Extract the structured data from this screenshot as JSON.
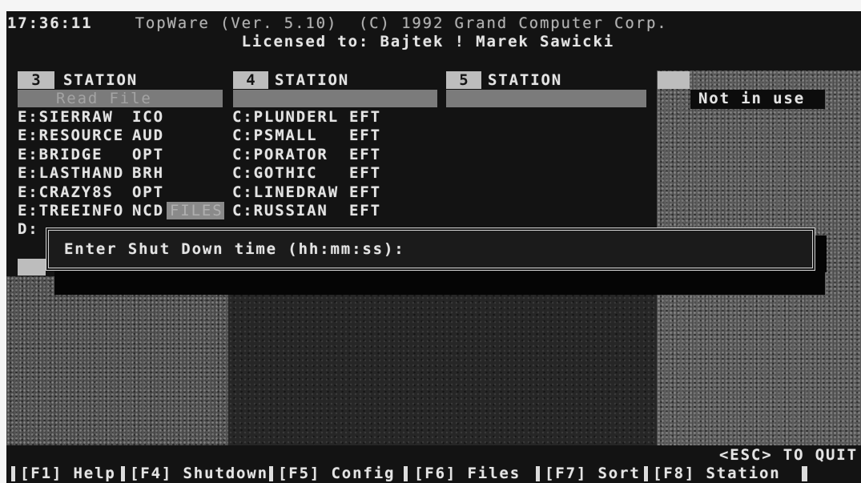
{
  "header": {
    "clock": "17:36:11",
    "title": "TopWare (Ver. 5.10)  (C) 1992 Grand Computer Corp.",
    "license": "Licensed to: Bajtek ! Marek Sawicki"
  },
  "panels": [
    {
      "number": "3",
      "label": "STATION",
      "status": "Read File",
      "highlight": "FILES",
      "drive_row": "D:",
      "files": [
        {
          "name": "E:SIERRAW",
          "ext": "ICO"
        },
        {
          "name": "E:RESOURCE",
          "ext": "AUD"
        },
        {
          "name": "E:BRIDGE",
          "ext": "OPT"
        },
        {
          "name": "E:LASTHAND",
          "ext": "BRH"
        },
        {
          "name": "E:CRAZY8S",
          "ext": "OPT"
        },
        {
          "name": "E:TREEINFO",
          "ext": "NCD"
        }
      ]
    },
    {
      "number": "4",
      "label": "STATION",
      "files": [
        {
          "name": "C:PLUNDERL",
          "ext": "EFT"
        },
        {
          "name": "C:PSMALL",
          "ext": "EFT"
        },
        {
          "name": "C:PORATOR",
          "ext": "EFT"
        },
        {
          "name": "C:GOTHIC",
          "ext": "EFT"
        },
        {
          "name": "C:LINEDRAW",
          "ext": "EFT"
        },
        {
          "name": "C:RUSSIAN",
          "ext": "EFT"
        }
      ]
    },
    {
      "number": "5",
      "label": "STATION",
      "files": []
    },
    {
      "status": "Not in use"
    }
  ],
  "dialog": {
    "prompt": "Enter Shut Down time (hh:mm:ss):"
  },
  "quit_hint": "<ESC> TO QUIT",
  "function_keys": [
    {
      "key": "[F1]",
      "label": "Help"
    },
    {
      "key": "[F4]",
      "label": "Shutdown"
    },
    {
      "key": "[F5]",
      "label": "Config"
    },
    {
      "key": "[F6]",
      "label": "Files"
    },
    {
      "key": "[F7]",
      "label": "Sort"
    },
    {
      "key": "[F8]",
      "label": "Station"
    }
  ],
  "colors": {
    "screen": "#131313",
    "text": "#e4e4e4",
    "dim_text": "#b3b3b3",
    "header_block": "#bdbdbd",
    "status_bar": "#7b7b7b",
    "status_text": "#a4a4a4",
    "frame": "#d2d2d2"
  }
}
